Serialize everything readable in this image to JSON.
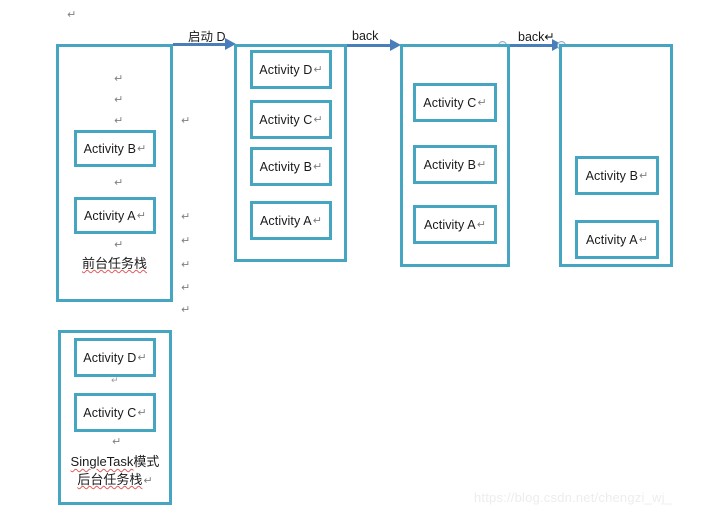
{
  "document": {
    "pilcrow_glyph": "↵",
    "top_mark": "↵",
    "watermark": "https://blog.csdn.net/chengzi_wj_"
  },
  "colors": {
    "stack_border": "#46A6C2",
    "box_border": "#46A6C2",
    "arrow": "#4A7EBB",
    "connector": "#8FA9C0",
    "text": "#1a1a1a",
    "pilcrow": "#808080",
    "spellcheck_underline": "#E05C5C",
    "watermark": "#EDEDED",
    "background": "#ffffff"
  },
  "stacks": [
    {
      "id": "foreground-stack",
      "caption_line1": "前台任务栈",
      "activities": [
        {
          "label": "Activity B",
          "mark": "↵"
        },
        {
          "label": "Activity A",
          "mark": "↵"
        }
      ],
      "inner_marks": [
        "↵",
        "↵",
        "↵",
        "↵",
        "↵"
      ]
    },
    {
      "id": "stack-after-launch-d",
      "activities": [
        {
          "label": "Activity D",
          "mark": "↵"
        },
        {
          "label": "Activity C",
          "mark": "↵"
        },
        {
          "label": "Activity B",
          "mark": "↵"
        },
        {
          "label": "Activity A",
          "mark": "↵"
        }
      ]
    },
    {
      "id": "stack-after-first-back",
      "activities": [
        {
          "label": "Activity C",
          "mark": "↵"
        },
        {
          "label": "Activity B",
          "mark": "↵"
        },
        {
          "label": "Activity A",
          "mark": "↵"
        }
      ]
    },
    {
      "id": "stack-after-second-back",
      "activities": [
        {
          "label": "Activity B",
          "mark": "↵"
        },
        {
          "label": "Activity A",
          "mark": "↵"
        }
      ]
    },
    {
      "id": "background-stack",
      "caption_line1_a": "SingleTask",
      "caption_line1_b": "模式",
      "caption_line2": "后台任务栈",
      "caption_line2_mark": "↵",
      "activities": [
        {
          "label": "Activity D",
          "mark": "↵"
        },
        {
          "label": "Activity C",
          "mark": "↵"
        }
      ],
      "inner_marks": [
        "↵"
      ]
    }
  ],
  "arrows": [
    {
      "id": "launch-d",
      "label": "启动 D"
    },
    {
      "id": "back-1",
      "label": "back"
    },
    {
      "id": "back-2",
      "label": "back",
      "mark": "↵"
    }
  ],
  "gutter_marks": [
    "↵",
    "↵",
    "↵",
    "↵",
    "↵",
    "↵"
  ]
}
